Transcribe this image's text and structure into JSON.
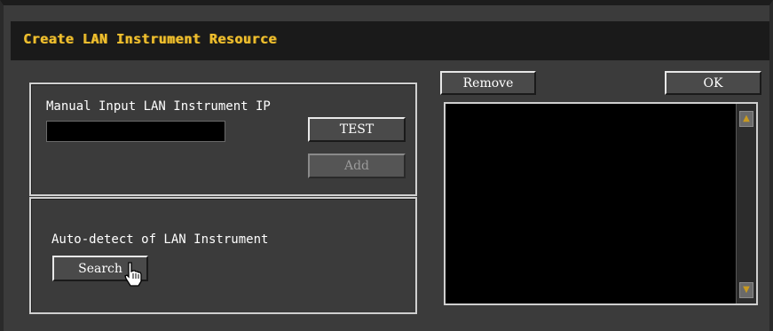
{
  "dialog": {
    "title": "Create LAN Instrument Resource"
  },
  "manual_section": {
    "label": "Manual Input LAN Instrument IP",
    "ip_value": "",
    "test_label": "TEST",
    "add_label": "Add"
  },
  "auto_section": {
    "label": "Auto-detect of LAN Instrument",
    "search_label": "Search"
  },
  "resource_list": {
    "remove_label": "Remove",
    "ok_label": "OK",
    "items": [],
    "scroll_up_icon": "triangle-up-icon",
    "scroll_down_icon": "triangle-down-icon"
  },
  "colors": {
    "title": "#f0c030",
    "background": "#3b3b3b",
    "titlebar": "#1a1a1a"
  }
}
